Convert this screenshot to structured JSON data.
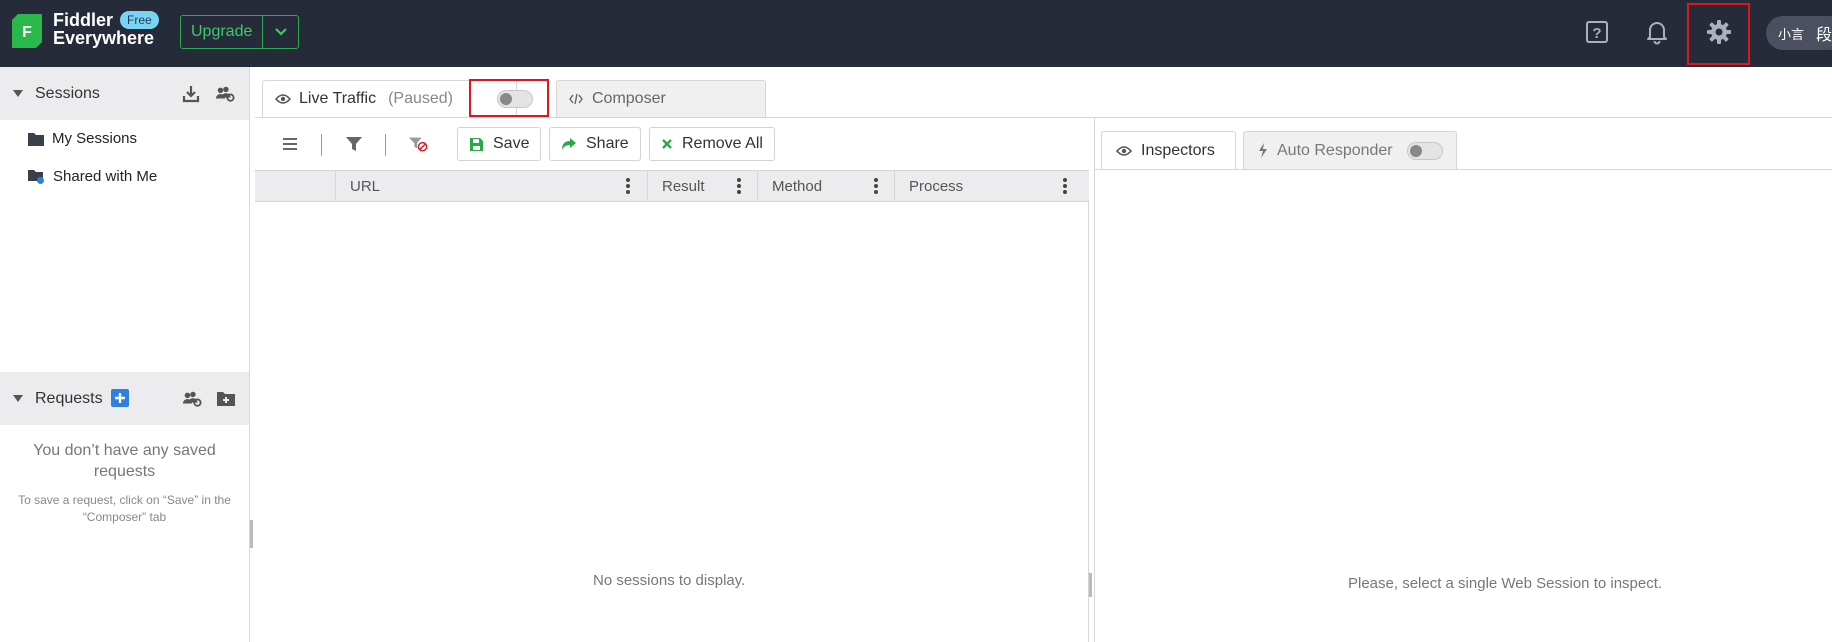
{
  "app": {
    "brand_line1": "Fiddler",
    "brand_line2": "Everywhere",
    "free_badge": "Free",
    "upgrade_label": "Upgrade",
    "user_initials": "小言",
    "user_name": "段小"
  },
  "sidebar": {
    "sessions_title": "Sessions",
    "items": [
      {
        "label": "My Sessions",
        "icon": "folder-icon"
      },
      {
        "label": "Shared with Me",
        "icon": "shared-folder-icon"
      }
    ],
    "requests_title": "Requests",
    "requests_empty_title": "You don’t have any saved requests",
    "requests_empty_hint": "To save a request, click on “Save” in the “Composer” tab"
  },
  "tabs": {
    "live_traffic": "Live Traffic",
    "paused": "(Paused)",
    "composer": "Composer"
  },
  "toolbar": {
    "save": "Save",
    "share": "Share",
    "remove_all": "Remove All"
  },
  "grid": {
    "columns": [
      "URL",
      "Result",
      "Method",
      "Process"
    ],
    "empty": "No sessions to display."
  },
  "inspector": {
    "inspectors_tab": "Inspectors",
    "auto_responder_tab": "Auto Responder",
    "empty": "Please, select a single Web Session to inspect."
  },
  "colors": {
    "topbar": "#262b3a",
    "brand_green": "#3cc96b",
    "highlight_red": "#e0161f",
    "add_blue": "#2f7fe0"
  }
}
